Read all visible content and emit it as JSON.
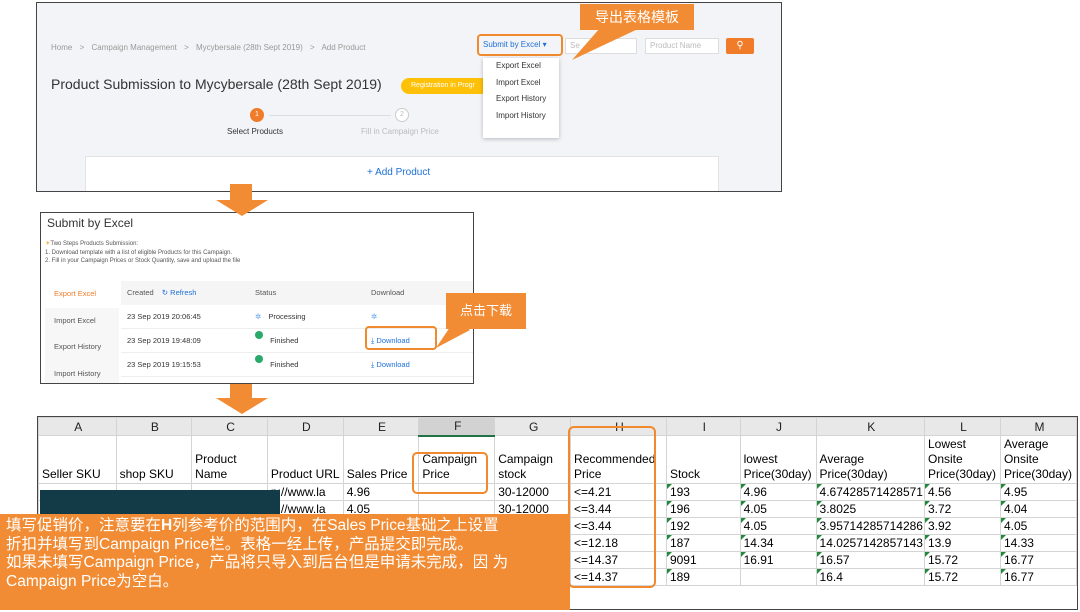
{
  "panel1": {
    "breadcrumb": [
      "Home",
      ">",
      "Campaign Management",
      ">",
      "Mycybersale (28th Sept 2019)",
      ">",
      "Add Product"
    ],
    "title": "Product Submission to Mycybersale (28th Sept 2019)",
    "badge": "Registration in Progr",
    "submit_dropdown": "Submit by Excel",
    "search1_placeholder": "Se",
    "search2_placeholder": "Product Name",
    "dropdown_items": [
      "Export Excel",
      "Import Excel",
      "Export History",
      "Import History"
    ],
    "steps": [
      {
        "number": "1",
        "label": "Select Products"
      },
      {
        "number": "2",
        "label": "Fill in Campaign Price"
      }
    ],
    "add_product": "+ Add Product"
  },
  "callouts": {
    "export_template": "导出表格模板",
    "click_download": "点击下载",
    "instructions": {
      "line1_a": "填写促销价，注意要在",
      "line1_b": "H",
      "line1_c": "列参考价的范围内，在Sales Price基础之上设置",
      "line2": "折扣并填写到Campaign Price栏。表格一经上传，产品提交即完成。",
      "line3": "如果未填写Campaign Price，产品将只导入到后台但是申请未完成，因 为",
      "line4": "Campaign Price为空白。"
    }
  },
  "panel2": {
    "title": "Submit by Excel",
    "note_title": "Two Steps Products Submission:",
    "note_line1": "1. Download template with a list of eligible Products for this Campaign.",
    "note_line2": "2. Fill in your Campaign Prices or Stock Quantity, save and upload the file",
    "sidebar": [
      "Export Excel",
      "Import Excel",
      "Export History",
      "Import History"
    ],
    "columns": {
      "created": "Created",
      "refresh": "Refresh",
      "status": "Status",
      "download": "Download"
    },
    "rows": [
      {
        "created": "23 Sep 2019 20:06:45",
        "status": "Processing",
        "download": ""
      },
      {
        "created": "23 Sep 2019 19:48:09",
        "status": "Finished",
        "download": "Download"
      },
      {
        "created": "23 Sep 2019 19:15:53",
        "status": "Finished",
        "download": "Download"
      }
    ]
  },
  "sheet": {
    "column_letters": [
      "A",
      "B",
      "C",
      "D",
      "E",
      "F",
      "G",
      "H",
      "I",
      "J",
      "K",
      "L",
      "M"
    ],
    "headers": [
      "Seller SKU",
      "shop SKU",
      "Product Name",
      "Product URL",
      "Sales Price",
      "Campaign Price",
      "Campaign stock",
      "Recommended Price",
      "Stock",
      "lowest Price(30day)",
      "Average Price(30day)",
      "Lowest Onsite Price(30day)",
      "Average Onsite Price(30day)"
    ],
    "rows": [
      [
        "",
        "",
        "",
        "p://www.la",
        "4.96",
        "",
        "30-12000",
        "<=4.21",
        "193",
        "4.96",
        "4.67428571428571",
        "4.56",
        "4.95"
      ],
      [
        "",
        "",
        "",
        "p://www.la",
        "4.05",
        "",
        "30-12000",
        "<=3.44",
        "196",
        "4.05",
        "3.8025",
        "3.72",
        "4.04"
      ],
      [
        "",
        "",
        "",
        "",
        "",
        "",
        "",
        "<=3.44",
        "192",
        "4.05",
        "3.95714285714286",
        "3.92",
        "4.05"
      ],
      [
        "",
        "",
        "",
        "",
        "",
        "",
        "",
        "<=12.18",
        "187",
        "14.34",
        "14.0257142857143",
        "13.9",
        "14.33"
      ],
      [
        "",
        "",
        "",
        "",
        "",
        "",
        "",
        "<=14.37",
        "9091",
        "16.91",
        "16.57",
        "15.72",
        "16.77"
      ],
      [
        "",
        "",
        "",
        "",
        "",
        "",
        "",
        "<=14.37",
        "189",
        "",
        "16.4",
        "15.72",
        "16.77"
      ]
    ]
  }
}
